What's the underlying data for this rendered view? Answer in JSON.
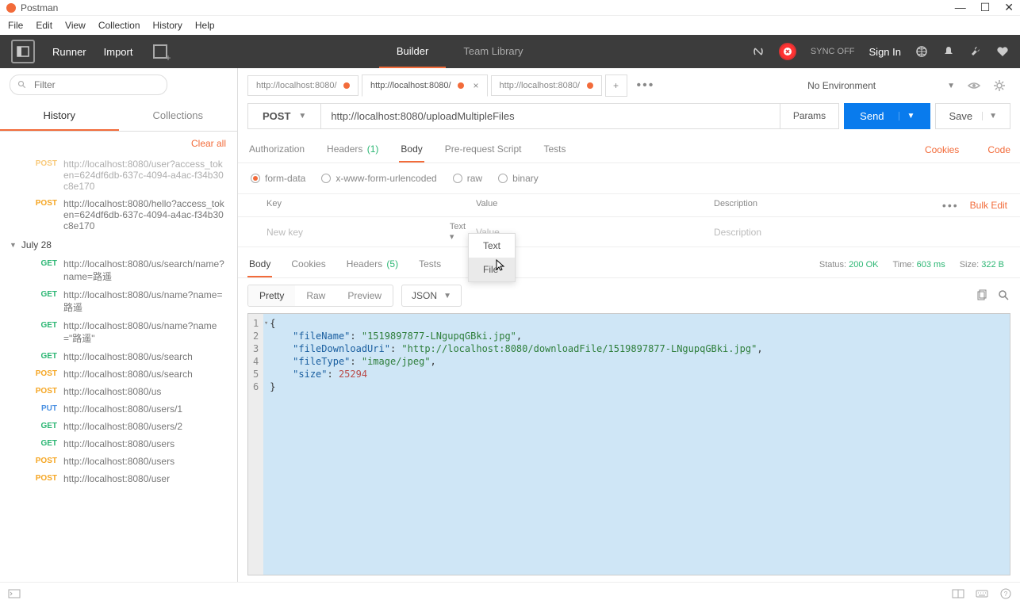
{
  "window": {
    "title": "Postman"
  },
  "menubar": [
    "File",
    "Edit",
    "View",
    "Collection",
    "History",
    "Help"
  ],
  "toolbar": {
    "runner": "Runner",
    "import": "Import",
    "builder": "Builder",
    "team_library": "Team Library",
    "sync_off": "SYNC OFF",
    "sign_in": "Sign In"
  },
  "sidebar": {
    "filter_placeholder": "Filter",
    "tab_history": "History",
    "tab_collections": "Collections",
    "clear_all": "Clear all",
    "items": [
      {
        "method": "POST",
        "cls": "method-post",
        "url": "http://localhost:8080/user?access_token=624df6db-637c-4094-a4ac-f34b30c8e170",
        "partial": true
      },
      {
        "method": "POST",
        "cls": "method-post",
        "url": "http://localhost:8080/hello?access_token=624df6db-637c-4094-a4ac-f34b30c8e170"
      }
    ],
    "date_group": "July 28",
    "items2": [
      {
        "method": "GET",
        "cls": "method-get",
        "url": "http://localhost:8080/us/search/name?name=路遥"
      },
      {
        "method": "GET",
        "cls": "method-get",
        "url": "http://localhost:8080/us/name?name=路遥"
      },
      {
        "method": "GET",
        "cls": "method-get",
        "url": "http://localhost:8080/us/name?name=\"路遥\""
      },
      {
        "method": "GET",
        "cls": "method-get",
        "url": "http://localhost:8080/us/search"
      },
      {
        "method": "POST",
        "cls": "method-post",
        "url": "http://localhost:8080/us/search"
      },
      {
        "method": "POST",
        "cls": "method-post",
        "url": "http://localhost:8080/us"
      },
      {
        "method": "PUT",
        "cls": "method-put",
        "url": "http://localhost:8080/users/1"
      },
      {
        "method": "GET",
        "cls": "method-get",
        "url": "http://localhost:8080/users/2"
      },
      {
        "method": "GET",
        "cls": "method-get",
        "url": "http://localhost:8080/users"
      },
      {
        "method": "POST",
        "cls": "method-post",
        "url": "http://localhost:8080/users"
      },
      {
        "method": "POST",
        "cls": "method-post",
        "url": "http://localhost:8080/user"
      }
    ]
  },
  "request_tabs": [
    {
      "label": "http://localhost:8080/",
      "dirty": true,
      "active": false
    },
    {
      "label": "http://localhost:8080/",
      "dirty": true,
      "active": true
    },
    {
      "label": "http://localhost:8080/",
      "dirty": true,
      "active": false
    }
  ],
  "environment": {
    "name": "No Environment"
  },
  "request": {
    "method": "POST",
    "url": "http://localhost:8080/uploadMultipleFiles",
    "params": "Params",
    "send": "Send",
    "save": "Save"
  },
  "req_nav": {
    "authorization": "Authorization",
    "headers": "Headers",
    "headers_count": "(1)",
    "body": "Body",
    "prerequest": "Pre-request Script",
    "tests": "Tests",
    "cookies": "Cookies",
    "code": "Code"
  },
  "body_types": {
    "formdata": "form-data",
    "urlencoded": "x-www-form-urlencoded",
    "raw": "raw",
    "binary": "binary"
  },
  "form_table": {
    "key": "Key",
    "value": "Value",
    "description": "Description",
    "bulk_edit": "Bulk Edit",
    "new_key": "New key",
    "type_text": "Text",
    "value_ph": "Value",
    "desc_ph": "Description"
  },
  "type_dropdown": {
    "text": "Text",
    "file": "File"
  },
  "resp_nav": {
    "body": "Body",
    "cookies": "Cookies",
    "headers": "Headers",
    "headers_count": "(5)",
    "tests": "Tests"
  },
  "resp_status": {
    "status_label": "Status:",
    "status_value": "200 OK",
    "time_label": "Time:",
    "time_value": "603 ms",
    "size_label": "Size:",
    "size_value": "322 B"
  },
  "resp_format": {
    "pretty": "Pretty",
    "raw": "Raw",
    "preview": "Preview",
    "json": "JSON"
  },
  "response_body": {
    "fileName": "1519897877-LNgupqGBki.jpg",
    "fileDownloadUri": "http://localhost:8080/downloadFile/1519897877-LNgupqGBki.jpg",
    "fileType": "image/jpeg",
    "size": 25294
  },
  "line_numbers": [
    "1",
    "2",
    "3",
    "4",
    "5",
    "6"
  ]
}
